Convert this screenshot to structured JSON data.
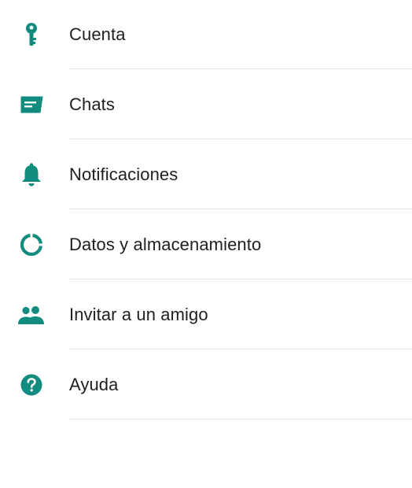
{
  "theme": {
    "accent": "#128c7e",
    "text": "#1f1f1f",
    "divider": "#e8e8e8"
  },
  "settings": {
    "items": [
      {
        "label": "Cuenta",
        "icon": "key-icon"
      },
      {
        "label": "Chats",
        "icon": "chat-icon"
      },
      {
        "label": "Notificaciones",
        "icon": "bell-icon"
      },
      {
        "label": "Datos y almacenamiento",
        "icon": "data-usage-icon"
      },
      {
        "label": "Invitar a un amigo",
        "icon": "people-icon"
      },
      {
        "label": "Ayuda",
        "icon": "help-icon"
      }
    ]
  }
}
